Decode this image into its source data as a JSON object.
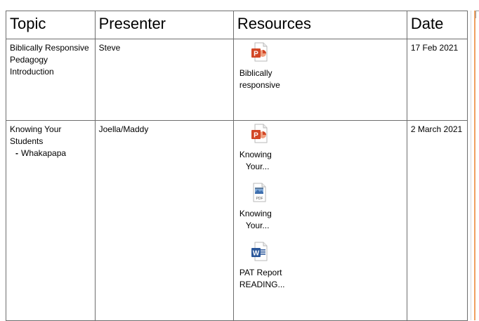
{
  "table": {
    "headers": {
      "topic": "Topic",
      "presenter": "Presenter",
      "resources": "Resources",
      "date": "Date"
    },
    "rows": [
      {
        "topic": "Biblically Responsive Pedagogy Introduction",
        "topic_subitem": "",
        "presenter": "Steve",
        "date": "17 Feb 2021",
        "attachments": [
          {
            "icon": "powerpoint-icon",
            "label_line1": "Biblically",
            "label_line2": "responsive"
          }
        ]
      },
      {
        "topic": "Knowing Your Students",
        "topic_subitem": "Whakapapa",
        "presenter": "Joella/Maddy",
        "date": "2 March 2021",
        "attachments": [
          {
            "icon": "powerpoint-icon",
            "label_line1": "Knowing",
            "label_line2": "Your..."
          },
          {
            "icon": "pdf-icon",
            "label_line1": "Knowing",
            "label_line2": "Your..."
          },
          {
            "icon": "word-icon",
            "label_line1": "PAT Report",
            "label_line2": "READING..."
          }
        ]
      }
    ]
  },
  "colors": {
    "border": "#6e6e6e",
    "powerpoint": "#d24726",
    "word": "#2b579a",
    "side_rule": "#f0a060"
  }
}
